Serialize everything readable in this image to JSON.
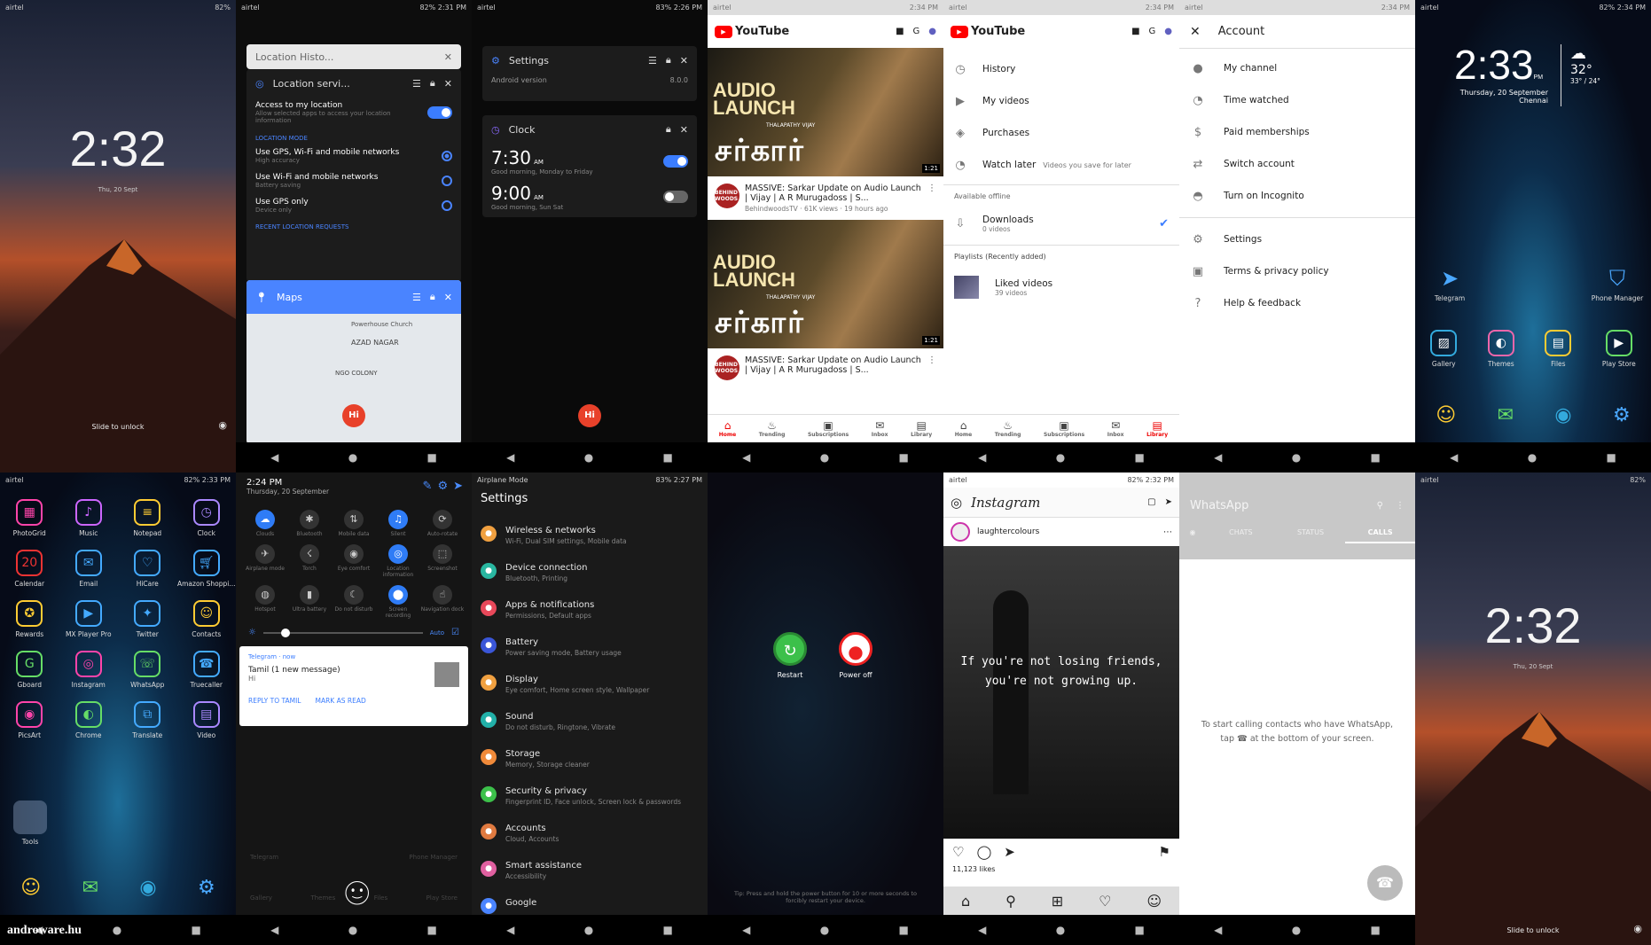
{
  "watermark": "androware.hu",
  "lock1": {
    "carrier": "airtel",
    "status": "82%",
    "time": "2:32",
    "date": "Thu, 20 Sept",
    "unlock": "Slide to unlock"
  },
  "recents": {
    "carrier": "airtel",
    "status": "82% 2:31 PM",
    "loc_history": "Location Histo...",
    "loc_title": "Location servi...",
    "access": "Access to my location",
    "access_sub": "Allow selected apps to access your location information",
    "mode_hdr": "LOCATION MODE",
    "modes": [
      {
        "t": "Use GPS, Wi-Fi and mobile networks",
        "s": "High accuracy"
      },
      {
        "t": "Use Wi-Fi and mobile networks",
        "s": "Battery saving"
      },
      {
        "t": "Use GPS only",
        "s": "Device only"
      }
    ],
    "recent_hdr": "RECENT LOCATION REQUESTS",
    "maps": "Maps",
    "map_labels": [
      "Powerhouse Church",
      "AZAD NAGAR",
      "NGO COLONY"
    ]
  },
  "clockcard": {
    "carrier": "airtel",
    "status": "83% 2:26 PM",
    "settings": "Settings",
    "android": "Android version",
    "android_val": "8.0.0",
    "clock": "Clock",
    "alarms": [
      {
        "time": "7:30",
        "ampm": "AM",
        "sub": "Good morning, Monday to Friday"
      },
      {
        "time": "9:00",
        "ampm": "AM",
        "sub": "Good morning, Sun Sat"
      }
    ]
  },
  "yt_home": {
    "logo": "YouTube",
    "thumb_text1": "AUDIO",
    "thumb_text2": "LAUNCH",
    "thumb_star": "THALAPATHY VIJAY",
    "thumb_tamil": "சர்கார்",
    "duration": "1:21",
    "channel_badge": "BEHIND WOODS",
    "videos": [
      {
        "title": "MASSIVE: Sarkar Update on Audio Launch | Vijay | A R Murugadoss | S...",
        "meta": "BehindwoodsTV · 61K views · 19 hours ago"
      },
      {
        "title": "MASSIVE: Sarkar Update on Audio Launch | Vijay | A R Murugadoss | S..."
      }
    ],
    "tabs": [
      "Home",
      "Trending",
      "Subscriptions",
      "Inbox",
      "Library"
    ]
  },
  "yt_library": {
    "items": [
      "History",
      "My videos",
      "Purchases",
      "Watch later"
    ],
    "watch_later_sub": "Videos you save for later",
    "offline_hdr": "Available offline",
    "downloads": "Downloads",
    "downloads_sub": "0 videos",
    "playlists_hdr": "Playlists (Recently added)",
    "liked": "Liked videos",
    "liked_sub": "39 videos"
  },
  "yt_account": {
    "title": "Account",
    "items": [
      "My channel",
      "Time watched",
      "Paid memberships",
      "Switch account",
      "Turn on Incognito"
    ],
    "items2": [
      "Settings",
      "Terms & privacy policy",
      "Help & feedback"
    ]
  },
  "home1": {
    "time": "2:33",
    "ampm": "PM",
    "date": "Thursday, 20 September",
    "city": "Chennai",
    "temp": "32°",
    "range": "33° / 24°",
    "apps_top": [
      "Telegram",
      "Phone Manager"
    ],
    "apps": [
      "Gallery",
      "Themes",
      "Files",
      "Play Store"
    ]
  },
  "drawer": {
    "carrier": "airtel",
    "status": "82% 2:33 PM",
    "apps": [
      "PhotoGrid",
      "Music",
      "Notepad",
      "Clock",
      "Calendar",
      "Email",
      "HiCare",
      "Amazon Shoppi...",
      "Rewards",
      "MX Player Pro",
      "Twitter",
      "Contacts",
      "Gboard",
      "Instagram",
      "WhatsApp",
      "Truecaller",
      "PicsArt",
      "Chrome",
      "Translate",
      "Video"
    ],
    "folder": "Tools",
    "cal_day": "20"
  },
  "notif": {
    "time": "2:24 PM",
    "date": "Thursday, 20 September",
    "tiles": [
      "Clouds",
      "Bluetooth",
      "Mobile data",
      "Silent",
      "Auto-rotate",
      "Airplane mode",
      "Torch",
      "Eye comfort",
      "Location information",
      "Screenshot",
      "Hotspot",
      "Ultra battery",
      "Do not disturb",
      "Screen recording",
      "Navigation dock"
    ],
    "auto": "Auto",
    "app": "Telegram · now",
    "msg_title": "Tamil (1 new message)",
    "msg": "Hi",
    "act1": "REPLY TO TAMIL",
    "act2": "MARK AS READ",
    "bg_labels": [
      "Telegram",
      "Phone Manager",
      "Gallery",
      "Themes",
      "Files",
      "Play Store"
    ]
  },
  "settings": {
    "mode": "Airplane Mode",
    "status": "83% 2:27 PM",
    "title": "Settings",
    "items": [
      {
        "t": "Wireless & networks",
        "s": "Wi-Fi, Dual SIM settings, Mobile data",
        "c": "#f0a040"
      },
      {
        "t": "Device connection",
        "s": "Bluetooth, Printing",
        "c": "#29b6a0"
      },
      {
        "t": "Apps & notifications",
        "s": "Permissions, Default apps",
        "c": "#e8485a"
      },
      {
        "t": "Battery",
        "s": "Power saving mode, Battery usage",
        "c": "#3a56d8"
      },
      {
        "t": "Display",
        "s": "Eye comfort, Home screen style, Wallpaper",
        "c": "#f0a040"
      },
      {
        "t": "Sound",
        "s": "Do not disturb, Ringtone, Vibrate",
        "c": "#22b0a8"
      },
      {
        "t": "Storage",
        "s": "Memory, Storage cleaner",
        "c": "#f08a3a"
      },
      {
        "t": "Security & privacy",
        "s": "Fingerprint ID, Face unlock, Screen lock & passwords",
        "c": "#3cc04a"
      },
      {
        "t": "Accounts",
        "s": "Cloud, Accounts",
        "c": "#e07a40"
      },
      {
        "t": "Smart assistance",
        "s": "Accessibility",
        "c": "#e060a0"
      },
      {
        "t": "Google",
        "s": "",
        "c": "#4a84ff"
      }
    ]
  },
  "power": {
    "restart": "Restart",
    "poweroff": "Power off",
    "tip": "Tip: Press and hold the power button for 10 or more seconds to forcibly restart your device."
  },
  "instagram": {
    "carrier": "airtel",
    "status": "82% 2:32 PM",
    "logo": "Instagram",
    "user": "laughtercolours",
    "quote": "If you're not losing friends, you're not growing up.",
    "likes": "11,123 likes"
  },
  "whatsapp": {
    "title": "WhatsApp",
    "tabs": [
      "CHATS",
      "STATUS",
      "CALLS"
    ],
    "msg": "To start calling contacts who have WhatsApp, tap ☎ at the bottom of your screen."
  },
  "lock2": {
    "carrier": "airtel",
    "status": "82%",
    "time": "2:32",
    "date": "Thu, 20 Sept",
    "unlock": "Slide to unlock"
  },
  "colors": {
    "blue": "#3b7dff",
    "yt_red": "#ff0000"
  },
  "nav": {
    "back": "◀",
    "home": "●",
    "recent": "■"
  }
}
